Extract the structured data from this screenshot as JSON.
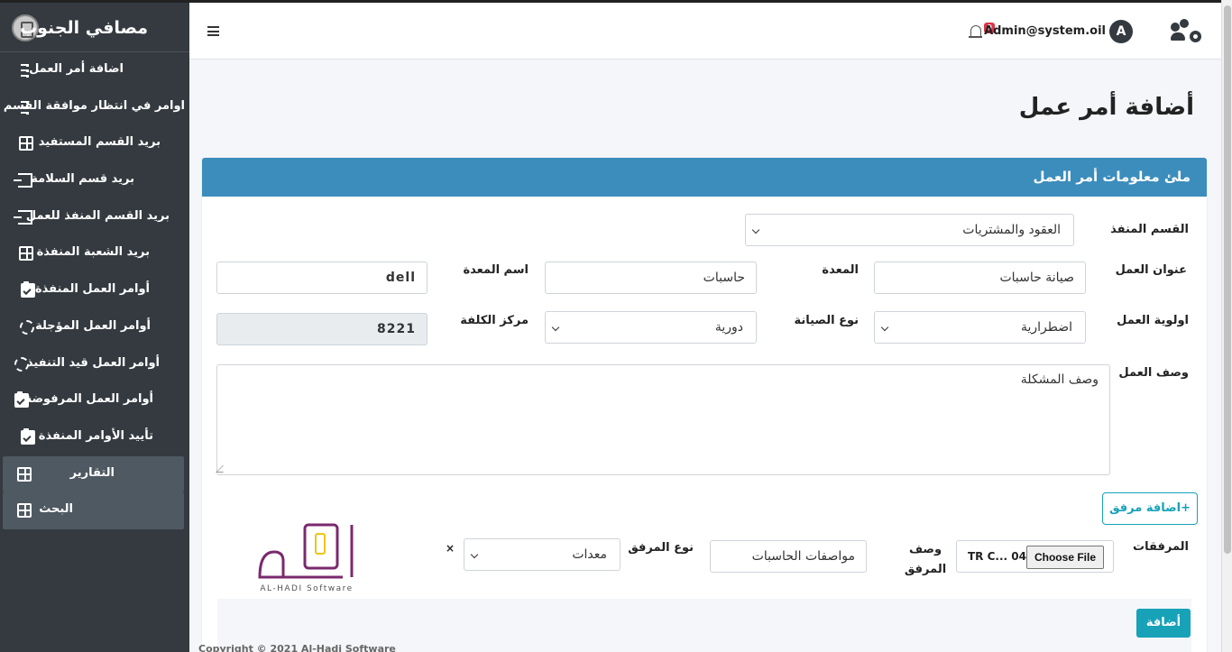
{
  "app": {
    "brand": "مصافي الجنوب",
    "user_email": "Admin@system.oil",
    "avatar_letter": "A",
    "notifications_count": "0",
    "copyright": "Copyright © 2021 Al-Hadi Software"
  },
  "sidebar": {
    "items": [
      {
        "label": "اضافة أمر العمل",
        "icon": "list-icon"
      },
      {
        "label": "اوامر في انتظار موافقة القسم",
        "icon": "list-icon"
      },
      {
        "label": "بريد القسم المستفيد",
        "icon": "grid-icon"
      },
      {
        "label": "بريد قسم السلامة",
        "icon": "sign-in-icon"
      },
      {
        "label": "بريد القسم المنفذ للعمل",
        "icon": "sign-in-icon"
      },
      {
        "label": "بريد الشعبة المنفذة",
        "icon": "grid-icon"
      },
      {
        "label": "أوامر العمل المنفذة",
        "icon": "clipboard-check-icon"
      },
      {
        "label": "أوامر العمل المؤجلة",
        "icon": "recycle-icon"
      },
      {
        "label": "أوامر العمل قيد التنفيذ",
        "icon": "recycle-icon"
      },
      {
        "label": "أوامر العمل المرفوضة",
        "icon": "clipboard-check-icon"
      },
      {
        "label": "تأييد الأوامر المنفذة",
        "icon": "clipboard-check-icon"
      },
      {
        "label": "التقارير",
        "icon": "grid-icon"
      },
      {
        "label": "البحث",
        "icon": "grid-icon"
      }
    ]
  },
  "page": {
    "title": "أضافة أمر عمل",
    "card_title": "ملئ معلومات أمر العمل"
  },
  "form": {
    "exec_dept": {
      "label": "القسم المنفذ",
      "value": "العقود والمشتريات"
    },
    "work_title": {
      "label": "عنوان العمل",
      "value": "صيانة حاسبات"
    },
    "equipment": {
      "label": "المعدة",
      "value": "حاسبات"
    },
    "equipment_name": {
      "label": "اسم المعدة",
      "value": "dell"
    },
    "priority": {
      "label": "اولوية العمل",
      "value": "اضطرارية"
    },
    "maint_type": {
      "label": "نوع الصيانة",
      "value": "دورية"
    },
    "cost_center": {
      "label": "مركز الكلفة",
      "value": "8221"
    },
    "description": {
      "label": "وصف العمل",
      "value": "وصف المشكلة"
    },
    "add_attachment": "+اضافة مرفق",
    "attachments_label": "المرفقات",
    "choose_file": "Choose File",
    "file_name": "TR C... 04",
    "attachment_desc": {
      "label": "وصف المرفق",
      "value": "مواصفات الحاسبات"
    },
    "attachment_type": {
      "label": "نوع المرفق",
      "value": "معدات"
    },
    "remove": "×",
    "submit": "أضافة"
  },
  "logo": {
    "caption": "AL-HADI Software",
    "color": "#7a2a6e",
    "accent": "#f0c419"
  },
  "colors": {
    "sidebar": "#343a40",
    "header": "#3c8dbc",
    "accent": "#17a2b8"
  }
}
